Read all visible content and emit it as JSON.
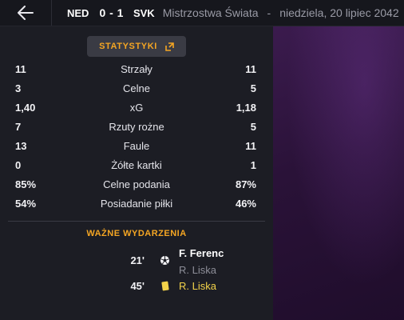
{
  "header": {
    "home_team": "NED",
    "score": "0 - 1",
    "away_team": "SVK",
    "competition": "Mistrzostwa Świata",
    "separator": "-",
    "date": "niedziela, 20 lipiec 2042"
  },
  "panel": {
    "stats_button_label": "STATYSTYKI",
    "stats": [
      {
        "home": "11",
        "label": "Strzały",
        "away": "11"
      },
      {
        "home": "3",
        "label": "Celne",
        "away": "5"
      },
      {
        "home": "1,40",
        "label": "xG",
        "away": "1,18"
      },
      {
        "home": "7",
        "label": "Rzuty rożne",
        "away": "5"
      },
      {
        "home": "13",
        "label": "Faule",
        "away": "11"
      },
      {
        "home": "0",
        "label": "Żółte kartki",
        "away": "1"
      },
      {
        "home": "85%",
        "label": "Celne podania",
        "away": "87%"
      },
      {
        "home": "54%",
        "label": "Posiadanie piłki",
        "away": "46%"
      }
    ],
    "events_title": "WAŻNE WYDARZENIA",
    "events": [
      {
        "minute": "21'",
        "type": "goal",
        "icon": "ball-icon",
        "player": "F. Ferenc",
        "assist": "R. Liska"
      },
      {
        "minute": "45'",
        "type": "yellow-card",
        "icon": "yellow-card-icon",
        "player": "R. Liska"
      }
    ]
  },
  "colors": {
    "accent": "#f5a623",
    "background": "#1c1d24",
    "header": "#16171d",
    "yellow_card": "#f3d34a"
  }
}
